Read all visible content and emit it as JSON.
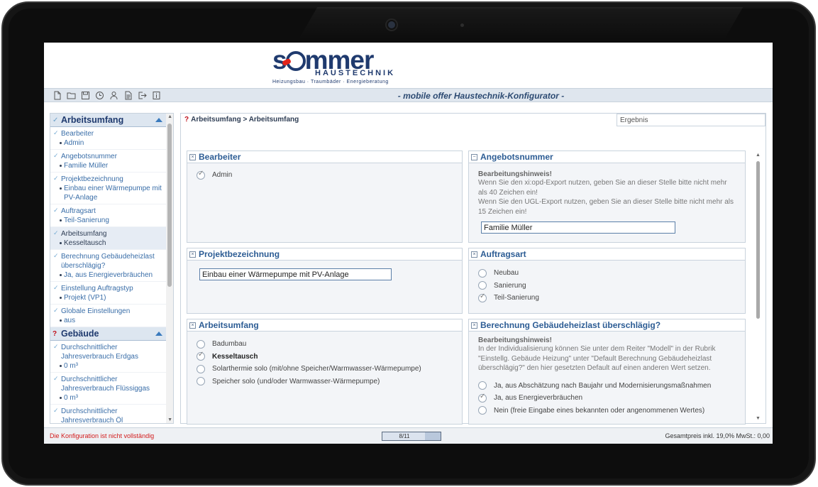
{
  "logo": {
    "word_start": "s",
    "word_end": "mmer",
    "subtitle": "HAUSTECHNIK",
    "tagline": "Heizungsbau · Traumbäder · Energieberatung",
    "brand_color": "#1f3a6e",
    "accent_color": "#e2231a"
  },
  "toolbar": {
    "icons": [
      "new-document-icon",
      "open-folder-icon",
      "save-icon",
      "history-clock-icon",
      "user-icon",
      "report-icon",
      "export-icon",
      "info-icon"
    ],
    "app_title": "- mobile offer Haustechnik-Konfigurator -"
  },
  "sidebar": {
    "section1_title": "Arbeitsumfang",
    "section2_title": "Gebäude",
    "items": [
      {
        "label": "Bearbeiter",
        "value": "Admin"
      },
      {
        "label": "Angebotsnummer",
        "value": "Familie Müller"
      },
      {
        "label": "Projektbezeichnung",
        "value": "Einbau einer Wärmepumpe mit PV-Anlage"
      },
      {
        "label": "Auftragsart",
        "value": "Teil-Sanierung"
      },
      {
        "label": "Arbeitsumfang",
        "value": "Kesseltausch"
      },
      {
        "label": "Berechnung Gebäudeheizlast überschlägig?",
        "value": "Ja, aus Energieverbräuchen"
      },
      {
        "label": "Einstellung Auftragstyp",
        "value": "Projekt (VP1)"
      },
      {
        "label": "Globale Einstellungen",
        "value": "aus"
      }
    ],
    "items2": [
      {
        "label": "Durchschnittlicher Jahresverbrauch Erdgas",
        "value": "0 m³"
      },
      {
        "label": "Durchschnittlicher Jahresverbrauch Flüssiggas",
        "value": "0 m³"
      },
      {
        "label": "Durchschnittlicher Jahresverbrauch Öl",
        "value": ""
      }
    ]
  },
  "main": {
    "breadcrumb_mark": "?",
    "breadcrumb": "Arbeitsumfang > Arbeitsumfang",
    "ergebnis": "Ergebnis",
    "bearbeiter": {
      "title": "Bearbeiter",
      "option": "Admin"
    },
    "angebotsnummer": {
      "title": "Angebotsnummer",
      "hint_title": "Bearbeitungshinweis!",
      "hint_1": "Wenn Sie den xi:opd-Export nutzen, geben Sie an dieser Stelle bitte nicht mehr als 40 Zeichen ein!",
      "hint_2": "Wenn Sie den UGL-Export nutzen, geben Sie an dieser Stelle bitte nicht mehr als 15 Zeichen ein!",
      "value": "Familie Müller"
    },
    "projektbezeichnung": {
      "title": "Projektbezeichnung",
      "value": "Einbau einer Wärmepumpe mit PV-Anlage"
    },
    "auftragsart": {
      "title": "Auftragsart",
      "options": [
        "Neubau",
        "Sanierung",
        "Teil-Sanierung"
      ]
    },
    "arbeitsumfang": {
      "title": "Arbeitsumfang",
      "options": [
        "Badumbau",
        "Kesseltausch",
        "Solarthermie solo (mit/ohne Speicher/Warmwasser-Wärmepumpe)",
        "Speicher solo (und/oder Warmwasser-Wärmepumpe)"
      ]
    },
    "heizlast": {
      "title": "Berechnung Gebäudeheizlast überschlägig?",
      "hint_title": "Bearbeitungshinweis!",
      "hint": "In der Individualisierung können Sie unter dem Reiter \"Modell\" in der Rubrik \"Einstellg. Gebäude Heizung\" unter \"Default Berechnung Gebäudeheizlast überschlägig?\" den hier gesetzten Default auf einen anderen Wert setzen.",
      "options": [
        "Ja, aus Abschätzung nach Baujahr und Modernisierungsmaßnahmen",
        "Ja, aus Energieverbräuchen",
        "Nein (freie Eingabe eines bekannten oder angenommenen Wertes)"
      ]
    }
  },
  "status": {
    "left": "Die Konfiguration ist nicht vollständig",
    "progress_text": "8/11",
    "progress_fraction": 0.727,
    "right": "Gesamtpreis inkl. 19,0% MwSt.: 0,00"
  }
}
